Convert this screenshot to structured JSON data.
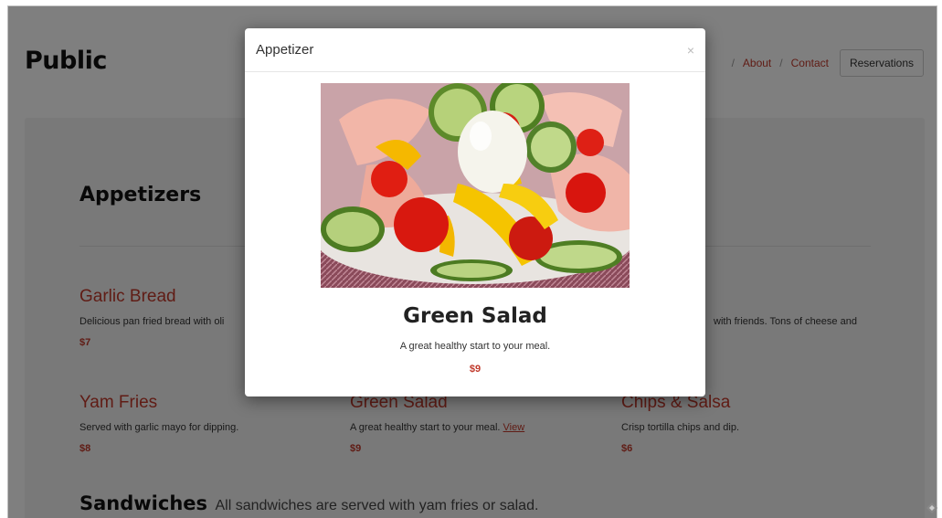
{
  "header": {
    "brand": "Public",
    "nav": {
      "about": "About",
      "contact": "Contact",
      "reservations": "Reservations",
      "separator": "/"
    }
  },
  "menu": {
    "section_title": "Appetizers",
    "items": [
      {
        "name": "Garlic Bread",
        "desc": "Delicious pan fried bread with oli",
        "price": "$7"
      },
      {
        "name": "",
        "desc": "with friends. Tons of cheese and",
        "price": ""
      },
      {
        "name": "Yam Fries",
        "desc": "Served with garlic mayo for dipping.",
        "price": "$8"
      },
      {
        "name": "Green Salad",
        "desc": "A great healthy start to your meal.",
        "link": "View",
        "price": "$9"
      },
      {
        "name": "Chips & Salsa",
        "desc": "Crisp tortilla chips and dip.",
        "price": "$6"
      }
    ],
    "section2_title": "Sandwiches",
    "section2_subtitle": "All sandwiches are served with yam fries or salad."
  },
  "modal": {
    "title": "Appetizer",
    "close": "×",
    "item_name": "Green Salad",
    "item_desc": "A great healthy start to your meal.",
    "item_price": "$9",
    "image_label": "salad-photo"
  },
  "colors": {
    "accent": "#c0392b",
    "overlay": "rgba(0,0,0,0.5)"
  }
}
